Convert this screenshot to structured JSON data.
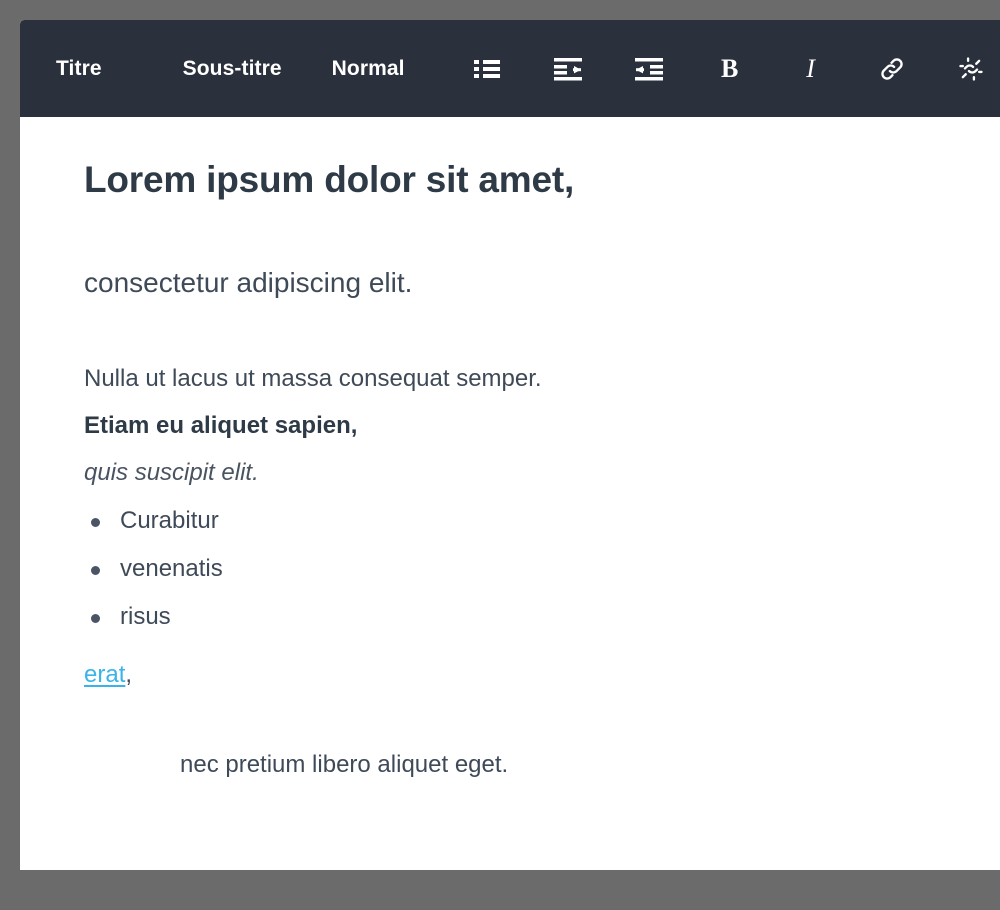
{
  "toolbar": {
    "style_titre": "Titre",
    "style_soustitre": "Sous-titre",
    "style_normal": "Normal",
    "icons": {
      "bullet_list": "bullet-list-icon",
      "outdent": "outdent-icon",
      "indent": "indent-icon",
      "bold": "B",
      "italic": "I",
      "link": "link-icon",
      "unlink": "unlink-icon"
    },
    "background_color": "#2b313c",
    "text_color": "#ffffff"
  },
  "document": {
    "title": "Lorem ipsum dolor sit amet,",
    "subtitle": "consectetur adipiscing elit.",
    "paragraphs": [
      "Nulla ut lacus ut massa consequat semper.",
      "Etiam eu aliquet sapien,",
      "quis suscipit elit."
    ],
    "list_items": [
      "Curabitur",
      "venenatis",
      "risus"
    ],
    "link_text": "erat",
    "link_trailing": ",",
    "link_color": "#3ab4e8",
    "indented_paragraph": "nec pretium libero aliquet eget."
  },
  "page": {
    "background_color": "#6b6b6b",
    "card_color": "#ffffff"
  }
}
